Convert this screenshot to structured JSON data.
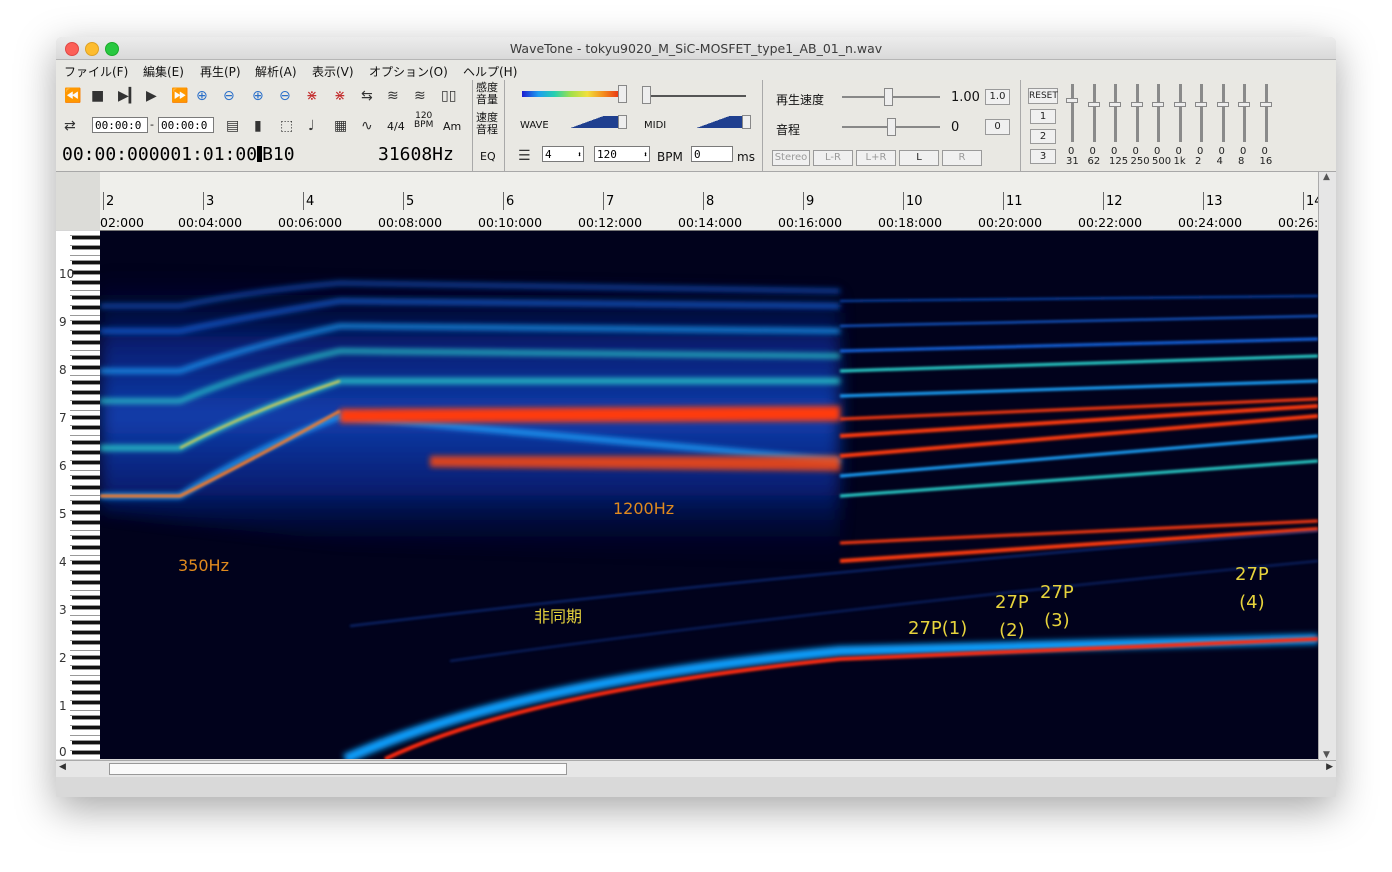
{
  "window": {
    "title": "WaveTone - tokyu9020_M_SiC-MOSFET_type1_AB_01_n.wav"
  },
  "menu": [
    "ファイル(F)",
    "編集(E)",
    "再生(P)",
    "解析(A)",
    "表示(V)",
    "オプション(O)",
    "ヘルプ(H)"
  ],
  "toolbar": {
    "range_start": "00:00:0",
    "range_end": "00:00:0",
    "time_sig": "4/4",
    "bpm_icon_top": "120",
    "bpm_icon_bottom": "BPM",
    "am_label": "Am",
    "clock": "00:00:000001:01:00",
    "note": "B10",
    "sample_rate": "31608Hz",
    "sens_label_1": "感度",
    "sens_label_2": "音量",
    "speed_label_1": "速度",
    "speed_label_2": "音程",
    "eq_label": "EQ",
    "wave_label": "WAVE",
    "midi_label": "MIDI",
    "beats_value": "4",
    "bpm_value": "120",
    "bpm_label": "BPM",
    "ms_value": "0",
    "ms_label": "ms",
    "playback_speed_label": "再生速度",
    "playback_speed_value": "1.00",
    "playback_speed_button": "1.0",
    "pitch_label": "音程",
    "pitch_value": "0",
    "pitch_button": "0",
    "channel_buttons": [
      "Stereo",
      "L-R",
      "L+R",
      "L",
      "R"
    ],
    "reset_label": "RESET",
    "preset_buttons": [
      "1",
      "2",
      "3"
    ],
    "eq_band_values": [
      "0",
      "0",
      "0",
      "0",
      "0",
      "0",
      "0",
      "0",
      "0",
      "0"
    ],
    "eq_band_freqs": [
      "31",
      "62",
      "125",
      "250",
      "500",
      "1k",
      "2",
      "4",
      "8",
      "16"
    ]
  },
  "ruler": {
    "measures": [
      "2",
      "3",
      "4",
      "5",
      "6",
      "7",
      "8",
      "9",
      "10",
      "11",
      "12",
      "13",
      "14"
    ],
    "times": [
      "02:000",
      "00:04:000",
      "00:06:000",
      "00:08:000",
      "00:10:000",
      "00:12:000",
      "00:14:000",
      "00:16:000",
      "00:18:000",
      "00:20:000",
      "00:22:000",
      "00:24:000",
      "00:26:"
    ]
  },
  "y_axis_labels": [
    "10",
    "9",
    "8",
    "7",
    "6",
    "5",
    "4",
    "3",
    "2",
    "1",
    "0"
  ],
  "annotations": {
    "a350": "350Hz",
    "a1200": "1200Hz",
    "async": "非同期",
    "p1": "27P(1)",
    "p2a": "27P",
    "p2b": "(2)",
    "p3a": "27P",
    "p3b": "(3)",
    "p4a": "27P",
    "p4b": "(4)"
  },
  "colors": {
    "annotation_orange": "#e08a1e",
    "annotation_yellow": "#e6d33c"
  }
}
